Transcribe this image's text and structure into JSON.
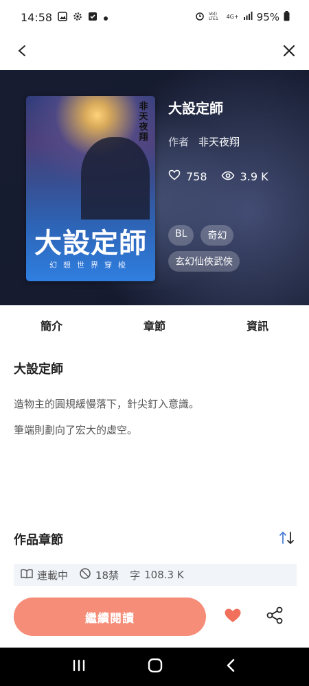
{
  "status": {
    "time": "14:58",
    "network": "4G+",
    "battery": "95%"
  },
  "book": {
    "title": "大設定師",
    "author_label": "作者",
    "author": "非天夜翔",
    "likes": "758",
    "views": "3.9 K",
    "tags": [
      "BL",
      "奇幻",
      "玄幻仙俠武俠"
    ],
    "cover": {
      "title": "大設定師",
      "subtitle": "幻想世界穿梭",
      "author": "非天夜翔"
    }
  },
  "tabs": [
    "簡介",
    "章節",
    "資訊"
  ],
  "intro": {
    "title": "大設定師",
    "lines": [
      "造物主的圓規緩慢落下，針尖釘入意識。",
      "筆端則劃向了宏大的虛空。"
    ]
  },
  "chapters": {
    "title": "作品章節",
    "status": "連載中",
    "rating": "18禁",
    "word_label": "字",
    "word_count": "108.3 K"
  },
  "actions": {
    "continue_label": "繼續閱讀"
  },
  "colors": {
    "accent": "#f58d78",
    "sort_icon": "#4a7fd4",
    "heart": "#f0705c"
  }
}
